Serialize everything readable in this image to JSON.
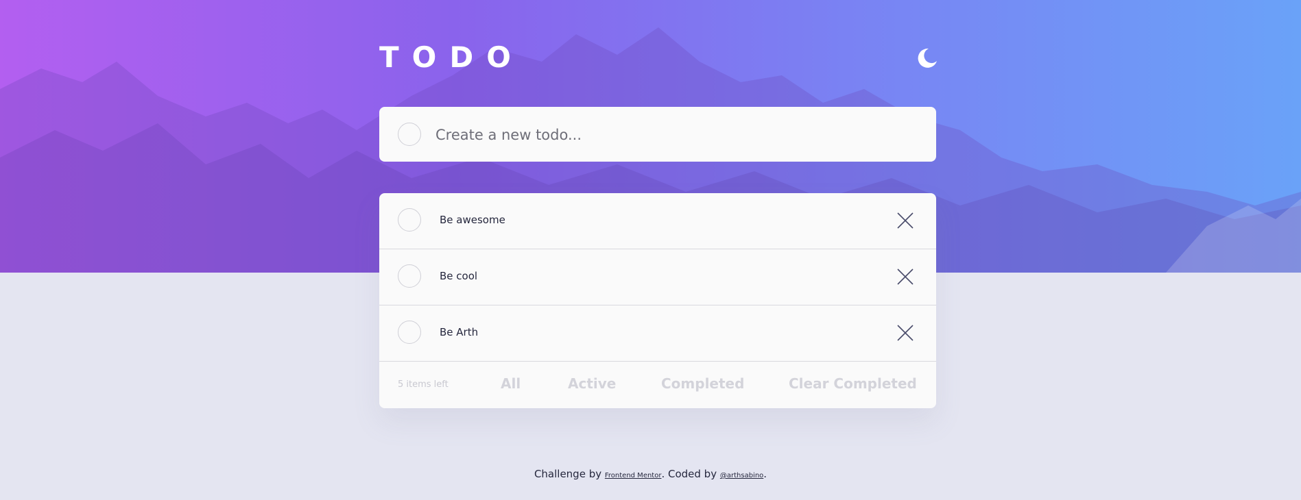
{
  "app": {
    "title": "TODO",
    "theme_icon": "moon-icon"
  },
  "new_todo": {
    "placeholder": "Create a new todo..."
  },
  "todos": [
    {
      "text": "Be awesome",
      "completed": false
    },
    {
      "text": "Be cool",
      "completed": false
    },
    {
      "text": "Be Arth",
      "completed": false
    }
  ],
  "footer": {
    "items_left": "5 items left",
    "filters": [
      "All",
      "Active",
      "Completed"
    ],
    "clear_label": "Clear Completed"
  },
  "attribution": {
    "prefix": "Challenge by ",
    "challenge_link": "Frontend Mentor",
    "middle": ". Coded by ",
    "author_link": "@arthsabino",
    "suffix": "."
  },
  "colors": {
    "gradient_start": "#b35ff0",
    "gradient_end": "#6aa2f8",
    "page_background": "#e4e5f1",
    "card_background": "#fafafa",
    "text_dark": "#25273d",
    "muted_text": "#d3d3da"
  }
}
